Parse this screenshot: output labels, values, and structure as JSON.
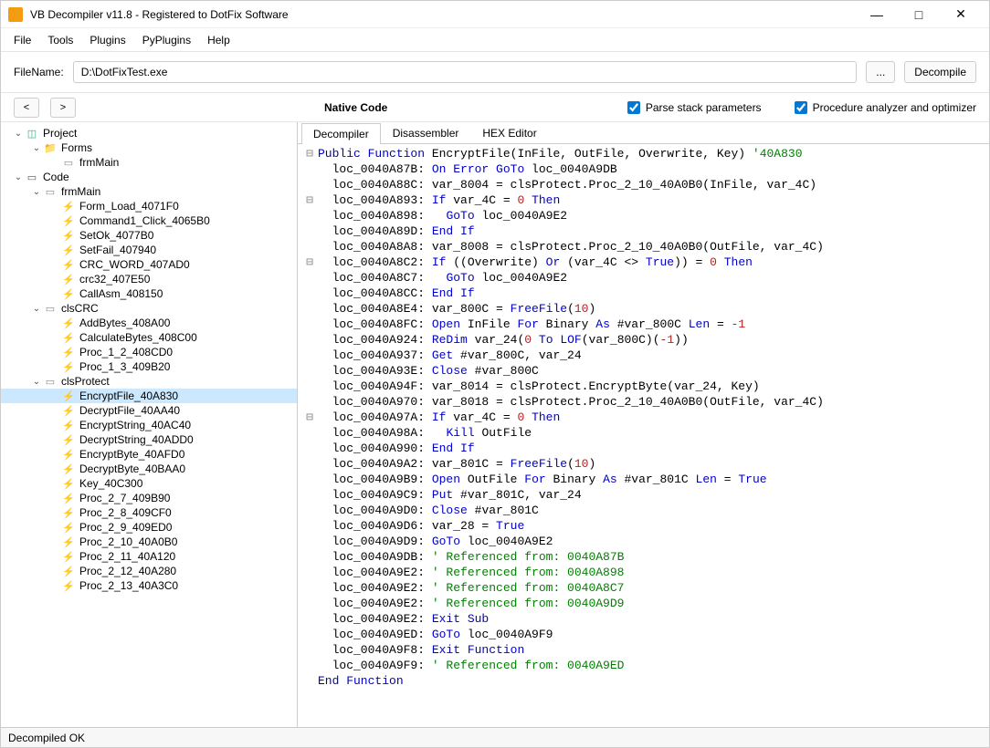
{
  "window": {
    "title": "VB Decompiler v11.8 - Registered to DotFix Software",
    "min": "—",
    "max": "□",
    "close": "✕"
  },
  "menu": [
    "File",
    "Tools",
    "Plugins",
    "PyPlugins",
    "Help"
  ],
  "toolbar": {
    "filename_label": "FileName:",
    "filename_value": "D:\\DotFixTest.exe",
    "browse_label": "...",
    "decompile_label": "Decompile"
  },
  "navbar": {
    "back": "<",
    "fwd": ">",
    "title": "Native Code",
    "chk1": "Parse stack parameters",
    "chk2": "Procedure analyzer and optimizer"
  },
  "code_tabs": [
    "Decompiler",
    "Disassembler",
    "HEX Editor"
  ],
  "tree": [
    {
      "d": 0,
      "t": "v",
      "i": "db",
      "l": "Project"
    },
    {
      "d": 1,
      "t": "v",
      "i": "folder",
      "l": "Forms"
    },
    {
      "d": 2,
      "t": "",
      "i": "form",
      "l": "frmMain"
    },
    {
      "d": 0,
      "t": "v",
      "i": "code",
      "l": "Code"
    },
    {
      "d": 1,
      "t": "v",
      "i": "form",
      "l": "frmMain"
    },
    {
      "d": 2,
      "t": "",
      "i": "fn-y",
      "l": "Form_Load_4071F0"
    },
    {
      "d": 2,
      "t": "",
      "i": "fn-y",
      "l": "Command1_Click_4065B0"
    },
    {
      "d": 2,
      "t": "",
      "i": "fn-b",
      "l": "SetOk_4077B0"
    },
    {
      "d": 2,
      "t": "",
      "i": "fn-b",
      "l": "SetFail_407940"
    },
    {
      "d": 2,
      "t": "",
      "i": "fn-b",
      "l": "CRC_WORD_407AD0"
    },
    {
      "d": 2,
      "t": "",
      "i": "fn-b",
      "l": "crc32_407E50"
    },
    {
      "d": 2,
      "t": "",
      "i": "fn-b",
      "l": "CallAsm_408150"
    },
    {
      "d": 1,
      "t": "v",
      "i": "form",
      "l": "clsCRC"
    },
    {
      "d": 2,
      "t": "",
      "i": "fn-b",
      "l": "AddBytes_408A00"
    },
    {
      "d": 2,
      "t": "",
      "i": "fn-b",
      "l": "CalculateBytes_408C00"
    },
    {
      "d": 2,
      "t": "",
      "i": "fn-g",
      "l": "Proc_1_2_408CD0"
    },
    {
      "d": 2,
      "t": "",
      "i": "fn-g",
      "l": "Proc_1_3_409B20"
    },
    {
      "d": 1,
      "t": "v",
      "i": "form",
      "l": "clsProtect"
    },
    {
      "d": 2,
      "t": "",
      "i": "fn-b",
      "l": "EncryptFile_40A830",
      "sel": true
    },
    {
      "d": 2,
      "t": "",
      "i": "fn-b",
      "l": "DecryptFile_40AA40"
    },
    {
      "d": 2,
      "t": "",
      "i": "fn-b",
      "l": "EncryptString_40AC40"
    },
    {
      "d": 2,
      "t": "",
      "i": "fn-b",
      "l": "DecryptString_40ADD0"
    },
    {
      "d": 2,
      "t": "",
      "i": "fn-b",
      "l": "EncryptByte_40AFD0"
    },
    {
      "d": 2,
      "t": "",
      "i": "fn-b",
      "l": "DecryptByte_40BAA0"
    },
    {
      "d": 2,
      "t": "",
      "i": "fn-b",
      "l": "Key_40C300"
    },
    {
      "d": 2,
      "t": "",
      "i": "fn-g",
      "l": "Proc_2_7_409B90"
    },
    {
      "d": 2,
      "t": "",
      "i": "fn-g",
      "l": "Proc_2_8_409CF0"
    },
    {
      "d": 2,
      "t": "",
      "i": "fn-g",
      "l": "Proc_2_9_409ED0"
    },
    {
      "d": 2,
      "t": "",
      "i": "fn-g",
      "l": "Proc_2_10_40A0B0"
    },
    {
      "d": 2,
      "t": "",
      "i": "fn-g",
      "l": "Proc_2_11_40A120"
    },
    {
      "d": 2,
      "t": "",
      "i": "fn-g",
      "l": "Proc_2_12_40A280"
    },
    {
      "d": 2,
      "t": "",
      "i": "fn-g",
      "l": "Proc_2_13_40A3C0"
    }
  ],
  "code": [
    {
      "g": "⊟",
      "h": "<span class='kw'>Public Function</span> EncryptFile(InFile, OutFile, Overwrite, Key) <span class='cm'>'40A830</span>"
    },
    {
      "g": "",
      "h": "  loc_0040A87B: <span class='kw'>On Error GoTo</span> loc_0040A9DB"
    },
    {
      "g": "",
      "h": "  loc_0040A88C: var_8004 = clsProtect.Proc_2_10_40A0B0(InFile, var_4C)"
    },
    {
      "g": "⊟",
      "h": "  loc_0040A893: <span class='kw'>If</span> var_4C = <span class='num'>0</span> <span class='kw'>Then</span>"
    },
    {
      "g": "",
      "h": "  loc_0040A898:   <span class='kw'>GoTo</span> loc_0040A9E2"
    },
    {
      "g": "",
      "h": "  loc_0040A89D: <span class='kw'>End If</span>"
    },
    {
      "g": "",
      "h": "  loc_0040A8A8: var_8008 = clsProtect.Proc_2_10_40A0B0(OutFile, var_4C)"
    },
    {
      "g": "⊟",
      "h": "  loc_0040A8C2: <span class='kw'>If</span> ((Overwrite) <span class='kw'>Or</span> (var_4C &lt;&gt; <span class='kw'>True</span>)) = <span class='num'>0</span> <span class='kw'>Then</span>"
    },
    {
      "g": "",
      "h": "  loc_0040A8C7:   <span class='kw'>GoTo</span> loc_0040A9E2"
    },
    {
      "g": "",
      "h": "  loc_0040A8CC: <span class='kw'>End If</span>"
    },
    {
      "g": "",
      "h": "  loc_0040A8E4: var_800C = <span class='kw'>FreeFile</span>(<span class='num'>10</span>)"
    },
    {
      "g": "",
      "h": "  loc_0040A8FC: <span class='kw'>Open</span> InFile <span class='kw'>For</span> Binary <span class='kw'>As</span> #var_800C <span class='kw'>Len</span> = <span class='num'>-1</span>"
    },
    {
      "g": "",
      "h": "  loc_0040A924: <span class='kw'>ReDim</span> var_24(<span class='num'>0</span> <span class='kw'>To</span> <span class='kw'>LOF</span>(var_800C)(<span class='num'>-1</span>))"
    },
    {
      "g": "",
      "h": "  loc_0040A937: <span class='kw'>Get</span> #var_800C, var_24"
    },
    {
      "g": "",
      "h": "  loc_0040A93E: <span class='kw'>Close</span> #var_800C"
    },
    {
      "g": "",
      "h": "  loc_0040A94F: var_8014 = clsProtect.EncryptByte(var_24, Key)"
    },
    {
      "g": "",
      "h": "  loc_0040A970: var_8018 = clsProtect.Proc_2_10_40A0B0(OutFile, var_4C)"
    },
    {
      "g": "⊟",
      "h": "  loc_0040A97A: <span class='kw'>If</span> var_4C = <span class='num'>0</span> <span class='kw'>Then</span>"
    },
    {
      "g": "",
      "h": "  loc_0040A98A:   <span class='kw'>Kill</span> OutFile"
    },
    {
      "g": "",
      "h": "  loc_0040A990: <span class='kw'>End If</span>"
    },
    {
      "g": "",
      "h": "  loc_0040A9A2: var_801C = <span class='kw'>FreeFile</span>(<span class='num'>10</span>)"
    },
    {
      "g": "",
      "h": "  loc_0040A9B9: <span class='kw'>Open</span> OutFile <span class='kw'>For</span> Binary <span class='kw'>As</span> #var_801C <span class='kw'>Len</span> = <span class='kw'>True</span>"
    },
    {
      "g": "",
      "h": "  loc_0040A9C9: <span class='kw'>Put</span> #var_801C, var_24"
    },
    {
      "g": "",
      "h": "  loc_0040A9D0: <span class='kw'>Close</span> #var_801C"
    },
    {
      "g": "",
      "h": "  loc_0040A9D6: var_28 = <span class='kw'>True</span>"
    },
    {
      "g": "",
      "h": "  loc_0040A9D9: <span class='kw'>GoTo</span> loc_0040A9E2"
    },
    {
      "g": "",
      "h": "  loc_0040A9DB: <span class='cm'>' Referenced from: 0040A87B</span>"
    },
    {
      "g": "",
      "h": "  loc_0040A9E2: <span class='cm'>' Referenced from: 0040A898</span>"
    },
    {
      "g": "",
      "h": "  loc_0040A9E2: <span class='cm'>' Referenced from: 0040A8C7</span>"
    },
    {
      "g": "",
      "h": "  loc_0040A9E2: <span class='cm'>' Referenced from: 0040A9D9</span>"
    },
    {
      "g": "",
      "h": "  loc_0040A9E2: <span class='kw'>Exit Sub</span>"
    },
    {
      "g": "",
      "h": "  loc_0040A9ED: <span class='kw'>GoTo</span> loc_0040A9F9"
    },
    {
      "g": "",
      "h": "  loc_0040A9F8: <span class='kw'>Exit Function</span>"
    },
    {
      "g": "",
      "h": "  loc_0040A9F9: <span class='cm'>' Referenced from: 0040A9ED</span>"
    },
    {
      "g": "",
      "h": "<span class='kw'>End Function</span>"
    }
  ],
  "status": "Decompiled OK"
}
